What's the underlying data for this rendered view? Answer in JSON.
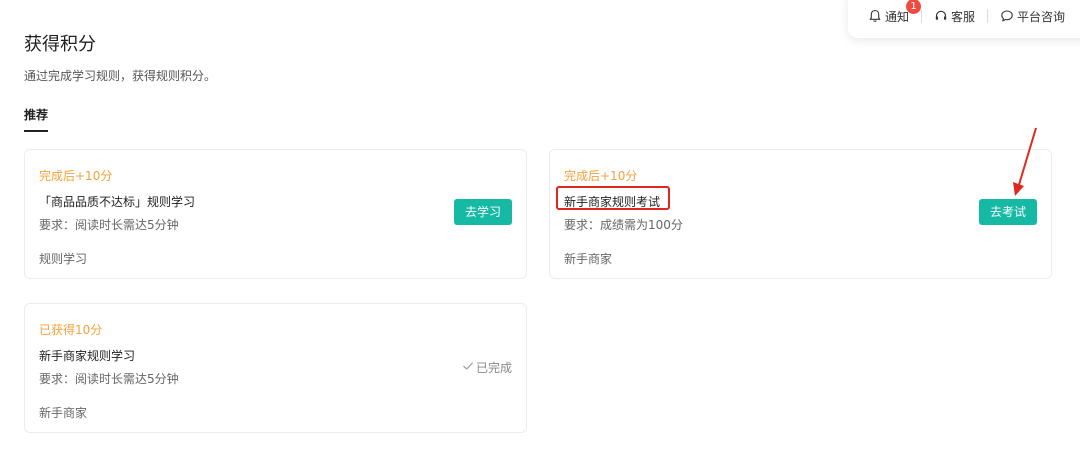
{
  "header": {
    "notify_label": "通知",
    "notify_badge": "1",
    "service_label": "客服",
    "consult_label": "平台咨询"
  },
  "page": {
    "title": "获得积分",
    "subtitle": "通过完成学习规则，获得规则积分。",
    "tab_label": "推荐"
  },
  "cards": [
    {
      "reward": "完成后+10分",
      "name": "「商品品质不达标」规则学习",
      "requirement": "要求：阅读时长需达5分钟",
      "category": "规则学习",
      "action_label": "去学习"
    },
    {
      "reward": "完成后+10分",
      "name": "新手商家规则考试",
      "requirement": "要求：成绩需为100分",
      "category": "新手商家",
      "action_label": "去考试"
    },
    {
      "reward": "已获得10分",
      "name": "新手商家规则学习",
      "requirement": "要求：阅读时长需达5分钟",
      "category": "新手商家",
      "status_label": "已完成"
    }
  ],
  "colors": {
    "accent": "#15b9a4",
    "reward": "#f5a13b",
    "annotation": "#e0271f",
    "badge": "#f04a3e"
  },
  "icons": {
    "notify": "bell-icon",
    "service": "headset-icon",
    "consult": "chat-bubble-icon",
    "done": "checkmark-icon"
  }
}
